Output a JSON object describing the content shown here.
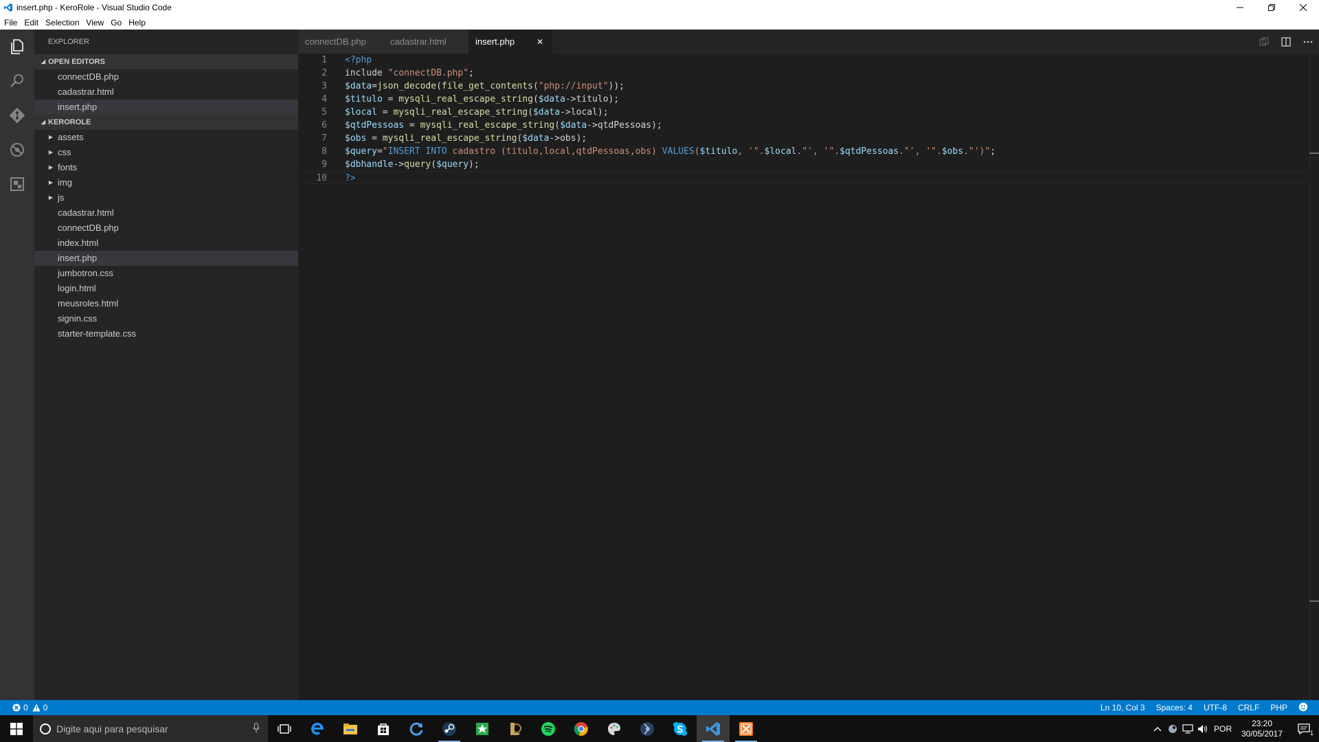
{
  "window": {
    "title": "insert.php - KeroRole - Visual Studio Code"
  },
  "menu": [
    "File",
    "Edit",
    "Selection",
    "View",
    "Go",
    "Help"
  ],
  "sidebar": {
    "header": "EXPLORER",
    "open_editors_title": "OPEN EDITORS",
    "open_editors": [
      "connectDB.php",
      "cadastrar.html",
      "insert.php"
    ],
    "project_title": "KEROROLE",
    "folders": [
      "assets",
      "css",
      "fonts",
      "img",
      "js"
    ],
    "files": [
      "cadastrar.html",
      "connectDB.php",
      "index.html",
      "insert.php",
      "jumbotron.css",
      "login.html",
      "meusroles.html",
      "signin.css",
      "starter-template.css"
    ]
  },
  "tabs": [
    "connectDB.php",
    "cadastrar.html",
    "insert.php"
  ],
  "editor": {
    "line_numbers": [
      "1",
      "2",
      "3",
      "4",
      "5",
      "6",
      "7",
      "8",
      "9",
      "10"
    ],
    "lines": [
      [
        [
          "tag",
          "<?php"
        ]
      ],
      [
        [
          "pl",
          "include "
        ],
        [
          "str",
          "\"connectDB.php\""
        ],
        [
          "pl",
          ";"
        ]
      ],
      [
        [
          "var",
          "$data"
        ],
        [
          "pl",
          "="
        ],
        [
          "fn",
          "json_decode"
        ],
        [
          "pl",
          "("
        ],
        [
          "fn",
          "file_get_contents"
        ],
        [
          "pl",
          "("
        ],
        [
          "str",
          "\"php://input\""
        ],
        [
          "pl",
          "));"
        ]
      ],
      [
        [
          "var",
          "$titulo"
        ],
        [
          "pl",
          " = "
        ],
        [
          "fn",
          "mysqli_real_escape_string"
        ],
        [
          "pl",
          "("
        ],
        [
          "var",
          "$data"
        ],
        [
          "pl",
          "->titulo);"
        ]
      ],
      [
        [
          "var",
          "$local"
        ],
        [
          "pl",
          " = "
        ],
        [
          "fn",
          "mysqli_real_escape_string"
        ],
        [
          "pl",
          "("
        ],
        [
          "var",
          "$data"
        ],
        [
          "pl",
          "->local);"
        ]
      ],
      [
        [
          "var",
          "$qtdPessoas"
        ],
        [
          "pl",
          " = "
        ],
        [
          "fn",
          "mysqli_real_escape_string"
        ],
        [
          "pl",
          "("
        ],
        [
          "var",
          "$data"
        ],
        [
          "pl",
          "->qtdPessoas);"
        ]
      ],
      [
        [
          "var",
          "$obs"
        ],
        [
          "pl",
          " = "
        ],
        [
          "fn",
          "mysqli_real_escape_string"
        ],
        [
          "pl",
          "("
        ],
        [
          "var",
          "$data"
        ],
        [
          "pl",
          "->obs);"
        ]
      ],
      [
        [
          "var",
          "$query"
        ],
        [
          "pl",
          "="
        ],
        [
          "str",
          "\""
        ],
        [
          "kw",
          "INSERT INTO"
        ],
        [
          "str",
          " cadastro (titulo,local,qtdPessoas,obs) "
        ],
        [
          "kw",
          "VALUES"
        ],
        [
          "str",
          "("
        ],
        [
          "var",
          "$titulo"
        ],
        [
          "str",
          ", '\"."
        ],
        [
          "var",
          "$local"
        ],
        [
          "str",
          ".\"', '\"."
        ],
        [
          "var",
          "$qtdPessoas"
        ],
        [
          "str",
          ".\"', '\"."
        ],
        [
          "var",
          "$obs"
        ],
        [
          "str",
          ".\"')\""
        ],
        [
          "pl",
          ";"
        ]
      ],
      [
        [
          "var",
          "$dbhandle"
        ],
        [
          "pl",
          "->"
        ],
        [
          "fn",
          "query"
        ],
        [
          "pl",
          "("
        ],
        [
          "var",
          "$query"
        ],
        [
          "pl",
          ");"
        ]
      ],
      [
        [
          "tag",
          "?>"
        ]
      ]
    ]
  },
  "statusbar": {
    "errors": "0",
    "warnings": "0",
    "position": "Ln 10, Col 3",
    "spaces": "Spaces: 4",
    "encoding": "UTF-8",
    "eol": "CRLF",
    "language": "PHP"
  },
  "taskbar": {
    "search_placeholder": "Digite aqui para pesquisar",
    "language": "POR",
    "time": "23:20",
    "date": "30/05/2017",
    "notifications": "1"
  },
  "colors": {
    "accent": "#007acc",
    "sidebar_bg": "#252526",
    "editor_bg": "#1e1e1e"
  }
}
